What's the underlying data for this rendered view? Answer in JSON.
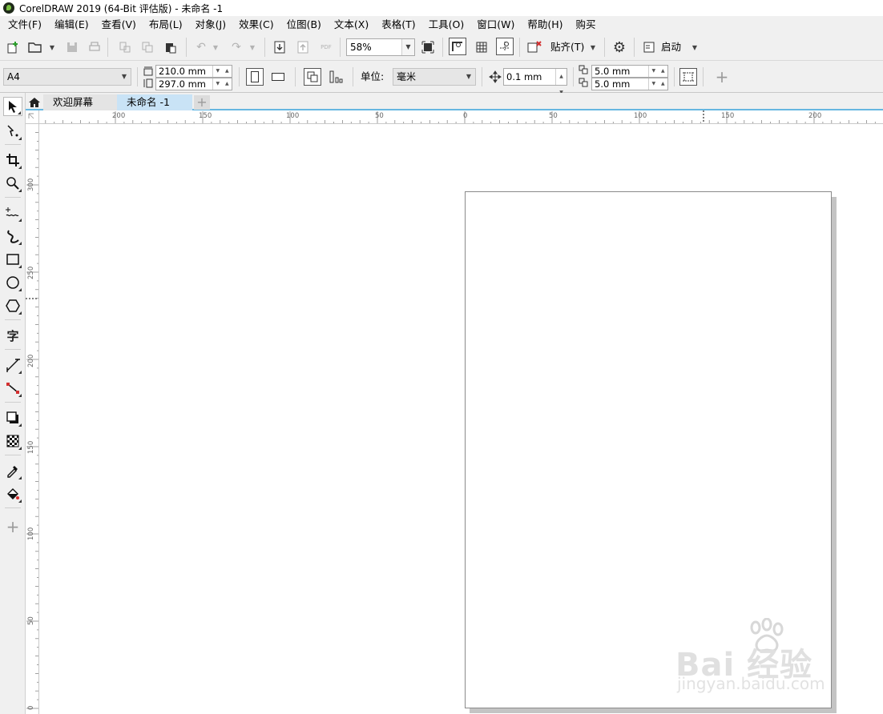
{
  "window": {
    "title": "CorelDRAW 2019 (64-Bit 评估版) - 未命名 -1"
  },
  "menu": [
    "文件(F)",
    "编辑(E)",
    "查看(V)",
    "布局(L)",
    "对象(J)",
    "效果(C)",
    "位图(B)",
    "文本(X)",
    "表格(T)",
    "工具(O)",
    "窗口(W)",
    "帮助(H)",
    "购买"
  ],
  "toolbar": {
    "zoom_value": "58%",
    "snap_label": "贴齐(T)",
    "launch_label": "启动"
  },
  "property_bar": {
    "page_size": "A4",
    "width_value": "210.0 mm",
    "height_value": "297.0 mm",
    "units_label": "单位:",
    "units_value": "毫米",
    "nudge_value": "0.1 mm",
    "dup_x_value": "5.0 mm",
    "dup_y_value": "5.0 mm"
  },
  "tabs": {
    "welcome": "欢迎屏幕",
    "document": "未命名 -1"
  },
  "toolbox": {
    "text_tool_glyph": "字"
  },
  "ruler": {
    "h_labels": [
      "200",
      "150",
      "100",
      "50",
      "0",
      "50",
      "100",
      "150",
      "200"
    ],
    "v_labels": [
      "300",
      "250",
      "200",
      "150",
      "100",
      "50",
      "0"
    ]
  },
  "watermark": {
    "main": "Bai 经验",
    "sub": "jingyan.baidu.com",
    "icon": "baidu-paw"
  }
}
